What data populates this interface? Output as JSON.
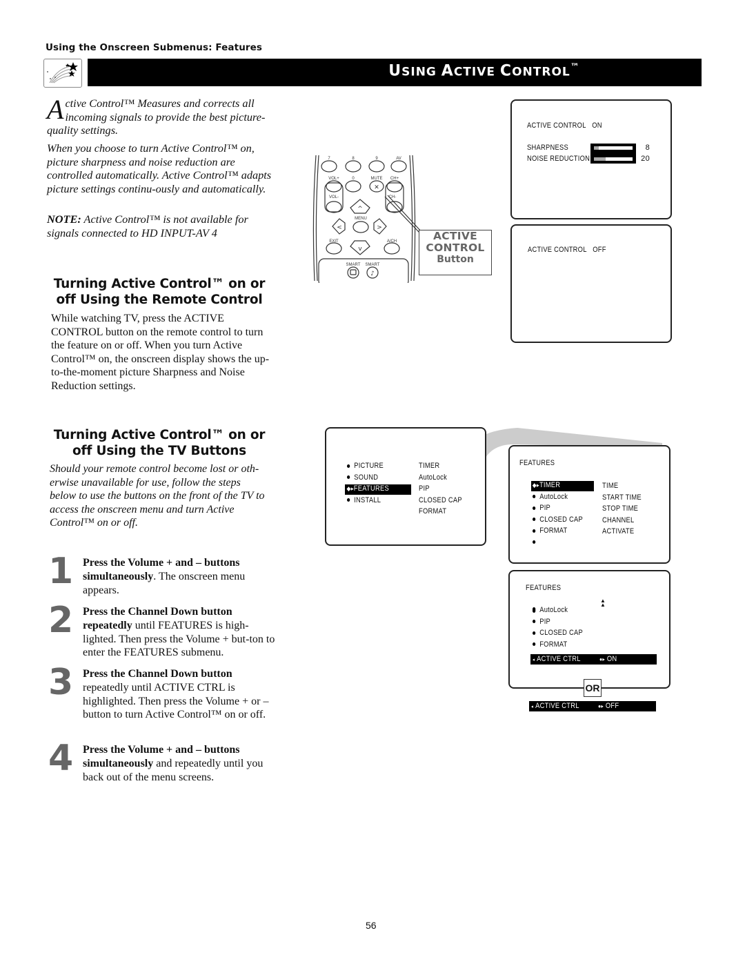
{
  "running_head": "Using the Onscreen Submenus: Features",
  "title": {
    "first_letters": [
      "U",
      "A",
      "C"
    ],
    "rest": [
      "SING ",
      "CTIVE ",
      "ONTROL"
    ],
    "tm": "™",
    "icon": "shooting-stars-icon"
  },
  "intro": {
    "dropcap": "A",
    "para1": "ctive Control™ Measures and corrects all incoming signals to provide the best picture-quality settings.",
    "para2": "When you choose to turn Active Control™ on, picture sharpness and noise reduction are controlled automatically. Active Control™ adapts picture settings continu-ously and automatically.",
    "note_label": "NOTE:",
    "note_text": " Active Control™ is not available for signals connected to HD INPUT-AV 4"
  },
  "remote_section": {
    "heading": "Turning Active Control™ on or off Using the Remote Control",
    "body": "While watching TV, press the ACTIVE CONTROL button on the remote control to turn the feature on or off. When you turn Active Control™ on, the onscreen display shows the up-to-the-moment picture Sharpness and Noise Reduction settings."
  },
  "tv_section": {
    "heading": "Turning Active Control™ on or off Using the TV Buttons",
    "body": "Should your remote control become lost or oth-erwise unavailable for use, follow the steps below to use the buttons on the front of the TV to access the onscreen menu and turn Active Control™ on or off."
  },
  "steps": [
    {
      "num": "1",
      "bold": "Press the Volume + and – buttons simultaneously",
      "text": ". The onscreen menu appears."
    },
    {
      "num": "2",
      "bold": "Press the Channel Down button repeatedly",
      "text": " until FEATURES is high-lighted. Then press the Volume + but-ton to enter the FEATURES submenu."
    },
    {
      "num": "3",
      "bold": "Press the Channel Down button",
      "text": " repeatedly until ACTIVE CTRL is highlighted. Then press the Volume + or – button to turn Active Control™ on or off."
    },
    {
      "num": "4",
      "bold": "Press the Volume + and – buttons simultaneously",
      "text": " and repeatedly until you back out of the menu screens."
    }
  ],
  "remote": {
    "labels": {
      "k7": "7",
      "k8": "8",
      "k9": "9",
      "av": "AV",
      "volp": "VOL+",
      "k0": "0",
      "mute": "MUTE",
      "chp": "CH+",
      "volm": "VOL-",
      "chm": "CH-",
      "menu": "MENU",
      "exit": "EXIT",
      "ach": "A/CH",
      "smart1": "SMART",
      "smart2": "SMART"
    },
    "callout": {
      "line1": "ACTIVE",
      "line2": "CONTROL",
      "line3": "Button"
    }
  },
  "screen_on": {
    "status_label": "ACTIVE  CONTROL",
    "status_value": "ON",
    "settings": [
      {
        "label": "SHARPNESS",
        "value": "8",
        "fill": 0.13
      },
      {
        "label": "NOISE  REDUCTION",
        "value": "20",
        "fill": 0.3
      }
    ]
  },
  "screen_off": {
    "status_label": "ACTIVE  CONTROL",
    "status_value": "OFF"
  },
  "main_menu": {
    "items": [
      "PICTURE",
      "SOUND",
      "FEATURES",
      "INSTALL"
    ],
    "selected": "FEATURES",
    "submenu": [
      "TIMER",
      "AutoLock",
      "PIP",
      "CLOSED  CAP",
      "FORMAT"
    ]
  },
  "features_menu": {
    "title": "FEATURES",
    "items": [
      "TIMER",
      "AutoLock",
      "PIP",
      "CLOSED  CAP",
      "FORMAT",
      ""
    ],
    "selected": "TIMER",
    "submenu": [
      "TIME",
      "START  TIME",
      "STOP  TIME",
      "CHANNEL",
      "ACTIVATE"
    ]
  },
  "ac_menu": {
    "title": "FEATURES",
    "items": [
      "AutoLock",
      "PIP",
      "CLOSED  CAP",
      "FORMAT"
    ],
    "row_label": "ACTIVE  CTRL",
    "on_value": "ON",
    "or_label": "OR",
    "off_value": "OFF"
  },
  "page_number": "56"
}
